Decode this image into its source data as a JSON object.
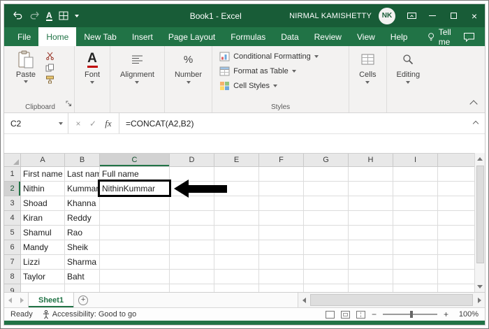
{
  "colors": {
    "titlebar": "#185c37",
    "tab_bar": "#217346",
    "accent": "#217346",
    "ribbon_bg": "#f3f2f1",
    "annotation": "#000000"
  },
  "titlebar": {
    "title": "Book1 - Excel",
    "user": "NIRMAL KAMISHETTY",
    "initials": "NK"
  },
  "ribbon_tabs": [
    {
      "label": "File",
      "active": false
    },
    {
      "label": "Home",
      "active": true
    },
    {
      "label": "New Tab",
      "active": false
    },
    {
      "label": "Insert",
      "active": false
    },
    {
      "label": "Page Layout",
      "active": false
    },
    {
      "label": "Formulas",
      "active": false
    },
    {
      "label": "Data",
      "active": false
    },
    {
      "label": "Review",
      "active": false
    },
    {
      "label": "View",
      "active": false
    },
    {
      "label": "Help",
      "active": false
    }
  ],
  "tell_me": "Tell me",
  "ribbon": {
    "paste": "Paste",
    "clipboard": "Clipboard",
    "font": "Font",
    "font_letter": "A",
    "alignment": "Alignment",
    "number": "Number",
    "percent": "%",
    "conditional_formatting": "Conditional Formatting",
    "format_as_table": "Format as Table",
    "cell_styles": "Cell Styles",
    "styles": "Styles",
    "cells": "Cells",
    "editing": "Editing"
  },
  "icons": {
    "cancel": "×",
    "enter": "✓",
    "underline_letter": "A",
    "close_window": "×"
  },
  "formula_bar": {
    "name_box": "C2",
    "fx": "fx",
    "formula": "=CONCAT(A2,B2)"
  },
  "grid": {
    "columns": [
      "A",
      "B",
      "C",
      "D",
      "E",
      "F",
      "G",
      "H",
      "I"
    ],
    "selected_column": "C",
    "selected_row": "2",
    "annotated_cell": "C2",
    "rows": [
      {
        "n": "1",
        "cells": {
          "A": "First name",
          "B": "Last name",
          "C": "Full name"
        }
      },
      {
        "n": "2",
        "cells": {
          "A": "Nithin",
          "B": "Kummar",
          "C": "NithinKummar"
        }
      },
      {
        "n": "3",
        "cells": {
          "A": "Shoad",
          "B": "Khanna"
        }
      },
      {
        "n": "4",
        "cells": {
          "A": "Kiran",
          "B": "Reddy"
        }
      },
      {
        "n": "5",
        "cells": {
          "A": "Shamul",
          "B": "Rao"
        }
      },
      {
        "n": "6",
        "cells": {
          "A": "Mandy",
          "B": "Sheik"
        }
      },
      {
        "n": "7",
        "cells": {
          "A": "Lizzi",
          "B": "Sharma"
        }
      },
      {
        "n": "8",
        "cells": {
          "A": "Taylor",
          "B": "Baht"
        }
      },
      {
        "n": "9",
        "cells": {}
      }
    ]
  },
  "sheet_bar": {
    "active_sheet": "Sheet1",
    "new_sheet": "+"
  },
  "status_bar": {
    "mode": "Ready",
    "accessibility": "Accessibility: Good to go",
    "zoom_minus": "−",
    "zoom_plus": "+",
    "zoom_level": "100%"
  }
}
